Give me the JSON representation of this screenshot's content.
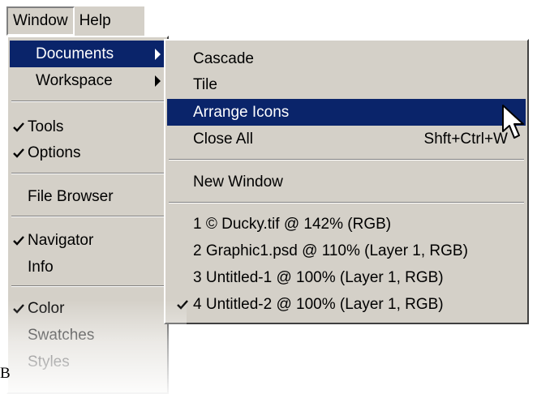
{
  "menubar": {
    "items": [
      "Window",
      "Help"
    ]
  },
  "window_menu": {
    "items": [
      {
        "label": "Documents",
        "submenu": true,
        "highlighted": true
      },
      {
        "label": "Workspace",
        "submenu": true
      },
      {
        "label": "Tools",
        "checked": true
      },
      {
        "label": "Options",
        "checked": true
      },
      {
        "label": "File Browser"
      },
      {
        "label": "Navigator",
        "checked": true
      },
      {
        "label": "Info"
      },
      {
        "label": "Color",
        "checked": true
      },
      {
        "label": "Swatches"
      },
      {
        "label": "Styles"
      }
    ]
  },
  "documents_menu": {
    "items": [
      {
        "label": "Cascade"
      },
      {
        "label": "Tile"
      },
      {
        "label": "Arrange Icons",
        "highlighted": true
      },
      {
        "label": "Close All",
        "shortcut": "Shft+Ctrl+W"
      },
      {
        "label": "New Window"
      },
      {
        "label": "1 © Ducky.tif @ 142% (RGB)"
      },
      {
        "label": "2 Graphic1.psd @ 110% (Layer 1, RGB)"
      },
      {
        "label": "3 Untitled-1 @ 100% (Layer 1, RGB)"
      },
      {
        "label": "4 Untitled-2 @ 100% (Layer 1, RGB)",
        "checked": true
      }
    ]
  },
  "corner_text": "B",
  "colors": {
    "highlight": "#0a246a",
    "menu_face": "#d4d0c8"
  },
  "icons": [
    "check-icon",
    "submenu-arrow-icon",
    "mouse-pointer-icon"
  ]
}
